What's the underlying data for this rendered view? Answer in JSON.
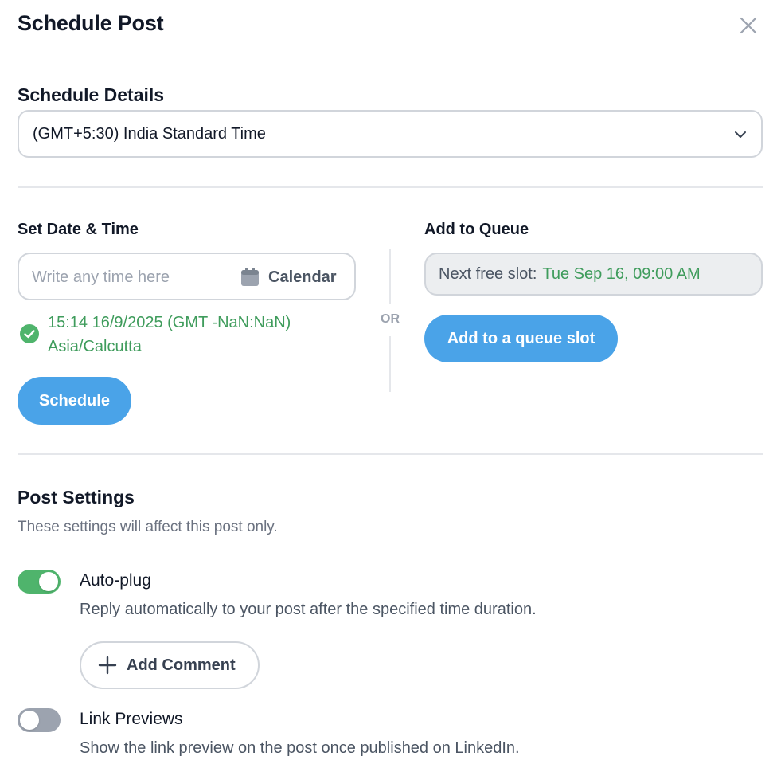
{
  "dialog": {
    "title": "Schedule Post",
    "close_icon": "close-icon"
  },
  "schedule_details": {
    "heading": "Schedule Details",
    "timezone_selected": "(GMT+5:30) India Standard Time",
    "dropdown_icon": "chevron-down-icon"
  },
  "set_date_time": {
    "label": "Set Date & Time",
    "input_placeholder": "Write any time here",
    "input_value": "",
    "calendar_icon": "calendar-icon",
    "calendar_label": "Calendar",
    "parsed_line1": "15:14 16/9/2025 (GMT -NaN:NaN)",
    "parsed_line2": "Asia/Calcutta",
    "check_icon": "check-circle-icon",
    "schedule_button": "Schedule"
  },
  "separator": {
    "or_label": "OR"
  },
  "add_to_queue": {
    "label": "Add to Queue",
    "next_slot_label": "Next free slot:",
    "next_slot_value": "Tue Sep 16, 09:00 AM",
    "queue_button": "Add to a queue slot"
  },
  "post_settings": {
    "heading": "Post Settings",
    "subtitle": "These settings will affect this post only.",
    "auto_plug": {
      "title": "Auto-plug",
      "enabled": true,
      "description": "Reply automatically to your post after the specified time duration.",
      "add_comment_label": "Add Comment",
      "plus_icon": "plus-icon"
    },
    "link_previews": {
      "title": "Link Previews",
      "enabled": false,
      "description": "Show the link preview on the post once published on LinkedIn."
    }
  },
  "colors": {
    "primary_blue": "#4aa3e8",
    "success_green": "#3f9c5c",
    "toggle_on": "#4fb46c",
    "toggle_off": "#9ca3af",
    "border": "#d1d5db"
  }
}
